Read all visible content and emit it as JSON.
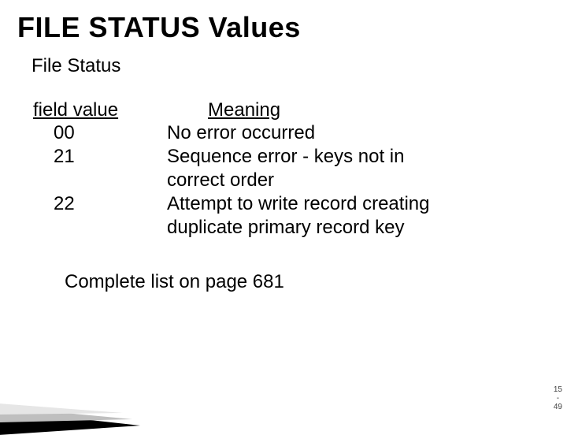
{
  "title": "FILE STATUS Values",
  "subtitle": "File Status",
  "headers": {
    "left": "field value",
    "right": "Meaning"
  },
  "rows": [
    {
      "code": "00",
      "meaning": "No error occurred"
    },
    {
      "code": "21",
      "meaning": "Sequence error - keys not in correct order"
    },
    {
      "code": "22",
      "meaning": "Attempt to write record creating duplicate primary record key"
    }
  ],
  "footnote": "Complete list on page 681",
  "pagenum": {
    "top": "15",
    "mid": "-",
    "bot": "49"
  }
}
